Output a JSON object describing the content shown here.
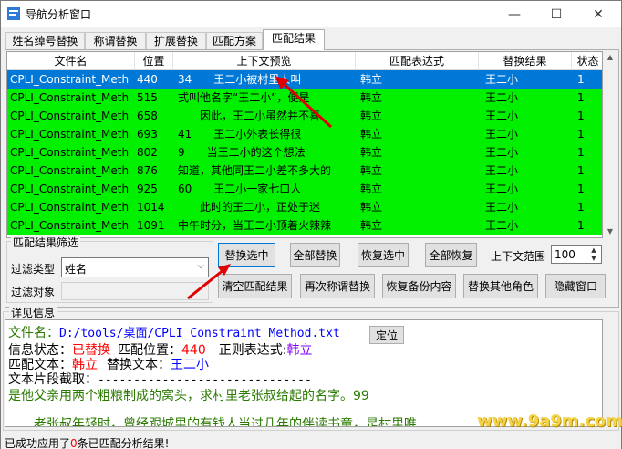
{
  "window": {
    "title": "导航分析窗口",
    "min": "—",
    "max": "☐",
    "close": "✕"
  },
  "tabs": [
    {
      "label": "姓名绰号替换"
    },
    {
      "label": "称谓替换"
    },
    {
      "label": "扩展替换"
    },
    {
      "label": "匹配方案"
    },
    {
      "label": "匹配结果",
      "active": true
    }
  ],
  "table": {
    "headers": [
      "文件名",
      "位置",
      "上下文预览",
      "匹配表达式",
      "替换结果",
      "状态"
    ],
    "rows": [
      {
        "file": "CPLI_Constraint_Meth",
        "pos": "440",
        "preview": "34　　王二小被村里人叫",
        "expr": "韩立",
        "result": "王二小",
        "status": "1",
        "selected": true
      },
      {
        "file": "CPLI_Constraint_Meth",
        "pos": "515",
        "preview": "式叫他名字“王二小”，便是",
        "expr": "韩立",
        "result": "王二小",
        "status": "1"
      },
      {
        "file": "CPLI_Constraint_Meth",
        "pos": "658",
        "preview": "　　因此，王二小虽然并不喜",
        "expr": "韩立",
        "result": "王二小",
        "status": "1"
      },
      {
        "file": "CPLI_Constraint_Meth",
        "pos": "693",
        "preview": "41　　王二小外表长得很",
        "expr": "韩立",
        "result": "王二小",
        "status": "1"
      },
      {
        "file": "CPLI_Constraint_Meth",
        "pos": "802",
        "preview": "9　　当王二小的这个想法",
        "expr": "韩立",
        "result": "王二小",
        "status": "1"
      },
      {
        "file": "CPLI_Constraint_Meth",
        "pos": "876",
        "preview": "知道，其他同王二小差不多大的",
        "expr": "韩立",
        "result": "王二小",
        "status": "1"
      },
      {
        "file": "CPLI_Constraint_Meth",
        "pos": "925",
        "preview": "60　　王二小一家七口人",
        "expr": "韩立",
        "result": "王二小",
        "status": "1"
      },
      {
        "file": "CPLI_Constraint_Meth",
        "pos": "1014",
        "preview": "　　此时的王二小，正处于迷",
        "expr": "韩立",
        "result": "王二小",
        "status": "1"
      },
      {
        "file": "CPLI_Constraint_Meth",
        "pos": "1091",
        "preview": "中午时分，当王二小顶着火辣辣",
        "expr": "韩立",
        "result": "王二小",
        "status": "1"
      }
    ]
  },
  "filter": {
    "group_title": "匹配结果筛选",
    "type_label": "过滤类型",
    "type_value": "姓名",
    "object_label": "过滤对象"
  },
  "buttons": {
    "replace_selected": "替换选中",
    "replace_all": "全部替换",
    "restore_selected": "恢复选中",
    "restore_all": "全部恢复",
    "context_range_label": "上下文范围",
    "context_range_value": "100",
    "clear_results": "清空匹配结果",
    "rereplace_titles": "再次称谓替换",
    "restore_backup": "恢复备份内容",
    "replace_other_role": "替换其他角色",
    "hide_window": "隐藏窗口"
  },
  "details": {
    "group_title": "详见信息",
    "file_label": "文件名：",
    "file_path": "D:/tools/桌面/CPLI_Constraint_Method.txt",
    "locate_button": "定位",
    "info_status_label": "信息状态：",
    "info_status_value": "已替换",
    "match_pos_label": "匹配位置：",
    "match_pos_value": "440",
    "regex_label": "正则表达式:",
    "regex_value": "韩立",
    "match_text_label": "匹配文本：",
    "match_text_value": "韩立",
    "replace_text_label": "替换文本：",
    "replace_text_value": "王二小",
    "snippet_label": "文本片段截取：",
    "snippet_rule": "------------------------------",
    "snippet_line1": "是他父亲用两个粗粮制成的窝头，求村里老张叔给起的名字。99",
    "snippet_line2": "　　老张叔年轻时，曾经跟城里的有钱人当过几年的伴读书童，是村里唯"
  },
  "status": {
    "prefix": "已成功应用了",
    "count": "0",
    "suffix": "条已匹配分析结果!"
  },
  "watermark": "www.9a9m.com",
  "colors": {
    "row_green": "#00f000",
    "row_selected": "#0078d7",
    "accent_red": "#ff0000",
    "accent_blue": "#0000ff",
    "text_olive": "#2a7a00",
    "regex_purple": "#8000ff"
  }
}
